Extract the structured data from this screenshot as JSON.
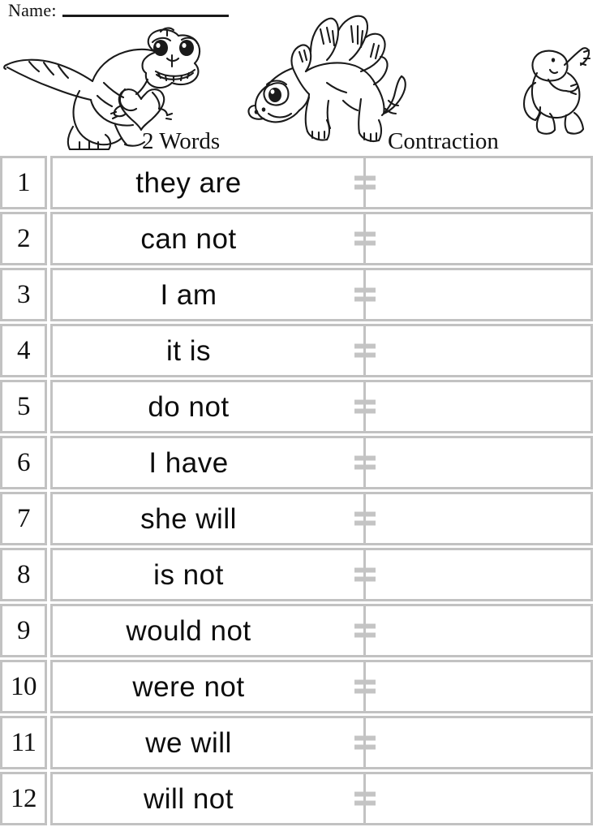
{
  "worksheet": {
    "name_label": "Name:",
    "name_value": "",
    "columns": {
      "left_heading": "2 Words",
      "right_heading": "Contraction"
    },
    "equals_symbol": "=",
    "border_color": "#c2c2c2",
    "text_color": "#111111",
    "rows": [
      {
        "number": "1",
        "words": "they are",
        "contraction": ""
      },
      {
        "number": "2",
        "words": "can not",
        "contraction": ""
      },
      {
        "number": "3",
        "words": "I am",
        "contraction": ""
      },
      {
        "number": "4",
        "words": "it is",
        "contraction": ""
      },
      {
        "number": "5",
        "words": "do not",
        "contraction": ""
      },
      {
        "number": "6",
        "words": "I have",
        "contraction": ""
      },
      {
        "number": "7",
        "words": "she will",
        "contraction": ""
      },
      {
        "number": "8",
        "words": "is not",
        "contraction": ""
      },
      {
        "number": "9",
        "words": "would not",
        "contraction": ""
      },
      {
        "number": "10",
        "words": "were not",
        "contraction": ""
      },
      {
        "number": "11",
        "words": "we will",
        "contraction": ""
      },
      {
        "number": "12",
        "words": "will not",
        "contraction": ""
      }
    ],
    "illustrations": [
      {
        "name": "tyrannosaurus-holding-heart"
      },
      {
        "name": "stegosaurus"
      },
      {
        "name": "baby-dinosaur-waving"
      }
    ]
  }
}
